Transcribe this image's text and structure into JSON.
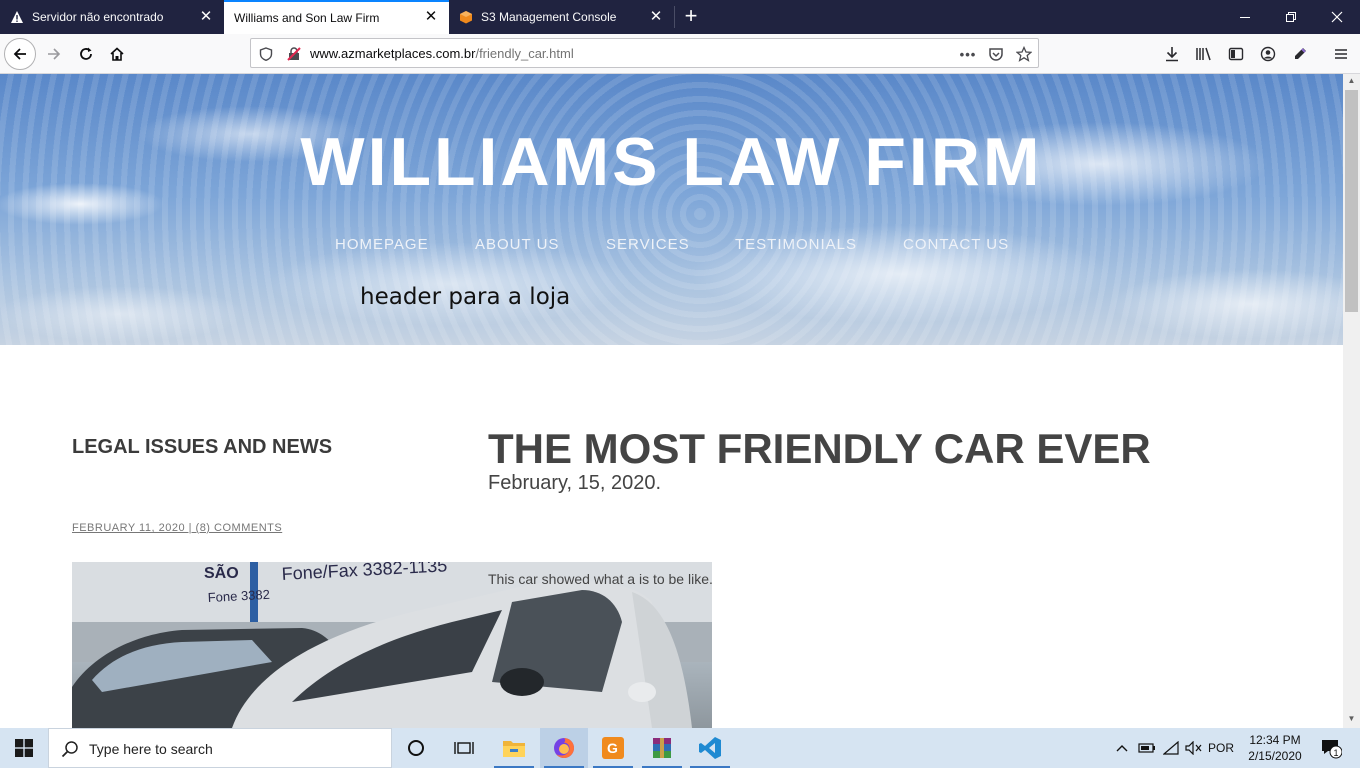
{
  "browser": {
    "tabs": [
      {
        "title": "Servidor não encontrado",
        "icon": "warning-icon"
      },
      {
        "title": "Williams and Son Law Firm",
        "icon": "page-icon"
      },
      {
        "title": "S3 Management Console",
        "icon": "aws-box-icon"
      }
    ],
    "active_tab_index": 1,
    "url_domain": "www.azmarketplaces.com.br",
    "url_path": "/friendly_car.html",
    "accent_color": "#0a84ff"
  },
  "page": {
    "site_title": "WILLIAMS LAW FIRM",
    "nav": [
      "HOMEPAGE",
      "ABOUT US",
      "SERVICES",
      "TESTIMONIALS",
      "CONTACT US"
    ],
    "header_caption": "header para a loja",
    "sidebar_heading": "LEGAL ISSUES AND NEWS",
    "sidebar_meta": "FEBRUARY 11, 2020 | (8) COMMENTS",
    "post_title": "THE MOST FRIENDLY CAR EVER",
    "post_date": "February, 15, 2020.",
    "post_body": "This car showed what a is to be like.",
    "photo_sign_text": "Fone/Fax 3382-1135",
    "photo_sign_text_2": "Fone 3382",
    "photo_sign_text_3": "SÃO"
  },
  "taskbar": {
    "search_placeholder": "Type here to search",
    "language": "POR",
    "time": "12:34 PM",
    "date": "2/15/2020",
    "notification_count": "1"
  }
}
